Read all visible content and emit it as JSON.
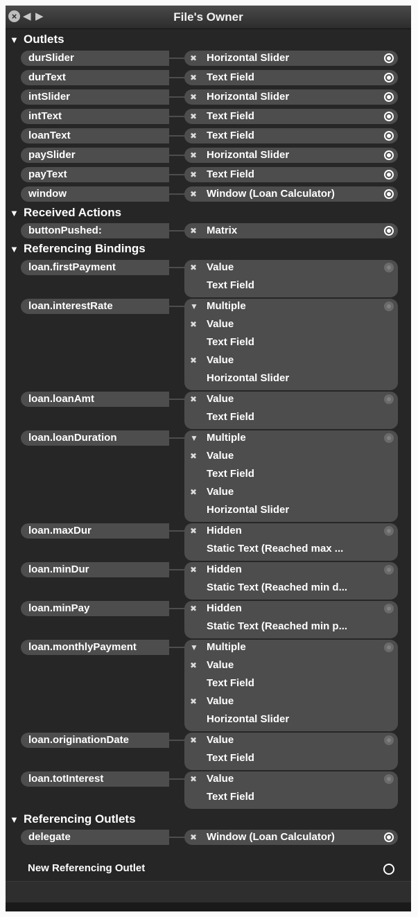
{
  "titlebar": {
    "title": "File's Owner",
    "close_icon": "close-icon",
    "back_icon": "back-arrow-icon",
    "forward_icon": "forward-arrow-icon"
  },
  "sections": {
    "outlets": "Outlets",
    "received_actions": "Received Actions",
    "referencing_bindings": "Referencing Bindings",
    "referencing_outlets": "Referencing Outlets"
  },
  "outlets": [
    {
      "name": "durSlider",
      "target": "Horizontal Slider"
    },
    {
      "name": "durText",
      "target": "Text Field"
    },
    {
      "name": "intSlider",
      "target": "Horizontal Slider"
    },
    {
      "name": "intText",
      "target": "Text Field"
    },
    {
      "name": "loanText",
      "target": "Text Field"
    },
    {
      "name": "paySlider",
      "target": "Horizontal Slider"
    },
    {
      "name": "payText",
      "target": "Text Field"
    },
    {
      "name": "window",
      "target": "Window (Loan Calculator)"
    }
  ],
  "received_actions": [
    {
      "name": "buttonPushed:",
      "target": "Matrix"
    }
  ],
  "bindings": [
    {
      "name": "loan.firstPayment",
      "lines": [
        {
          "mark": "x",
          "text": "Value"
        },
        {
          "mark": "",
          "text": "Text Field"
        }
      ]
    },
    {
      "name": "loan.interestRate",
      "lines": [
        {
          "mark": "tri",
          "text": "Multiple"
        },
        {
          "mark": "x",
          "text": "Value"
        },
        {
          "mark": "",
          "text": "Text Field"
        },
        {
          "mark": "x",
          "text": "Value"
        },
        {
          "mark": "",
          "text": "Horizontal Slider"
        }
      ]
    },
    {
      "name": "loan.loanAmt",
      "lines": [
        {
          "mark": "x",
          "text": "Value"
        },
        {
          "mark": "",
          "text": "Text Field"
        }
      ]
    },
    {
      "name": "loan.loanDuration",
      "lines": [
        {
          "mark": "tri",
          "text": "Multiple"
        },
        {
          "mark": "x",
          "text": "Value"
        },
        {
          "mark": "",
          "text": "Text Field"
        },
        {
          "mark": "x",
          "text": "Value"
        },
        {
          "mark": "",
          "text": "Horizontal Slider"
        }
      ]
    },
    {
      "name": "loan.maxDur",
      "lines": [
        {
          "mark": "x",
          "text": "Hidden"
        },
        {
          "mark": "",
          "text": "Static Text (Reached max ..."
        }
      ]
    },
    {
      "name": "loan.minDur",
      "lines": [
        {
          "mark": "x",
          "text": "Hidden"
        },
        {
          "mark": "",
          "text": "Static Text (Reached min d..."
        }
      ]
    },
    {
      "name": "loan.minPay",
      "lines": [
        {
          "mark": "x",
          "text": "Hidden"
        },
        {
          "mark": "",
          "text": "Static Text (Reached min p..."
        }
      ]
    },
    {
      "name": "loan.monthlyPayment",
      "lines": [
        {
          "mark": "tri",
          "text": "Multiple"
        },
        {
          "mark": "x",
          "text": "Value"
        },
        {
          "mark": "",
          "text": "Text Field"
        },
        {
          "mark": "x",
          "text": "Value"
        },
        {
          "mark": "",
          "text": "Horizontal Slider"
        }
      ]
    },
    {
      "name": "loan.originationDate",
      "lines": [
        {
          "mark": "x",
          "text": "Value"
        },
        {
          "mark": "",
          "text": "Text Field"
        }
      ]
    },
    {
      "name": "loan.totInterest",
      "lines": [
        {
          "mark": "x",
          "text": "Value"
        },
        {
          "mark": "",
          "text": "Text Field"
        }
      ]
    }
  ],
  "referencing_outlets": [
    {
      "name": "delegate",
      "target": "Window (Loan Calculator)"
    }
  ],
  "new_referencing_outlet": "New Referencing Outlet",
  "glyphs": {
    "x": "✖",
    "tri": "▼",
    "section_tri": "▼"
  },
  "colors": {
    "panel": "#262626",
    "pill": "#4d4d4d",
    "text": "#ffffff"
  }
}
